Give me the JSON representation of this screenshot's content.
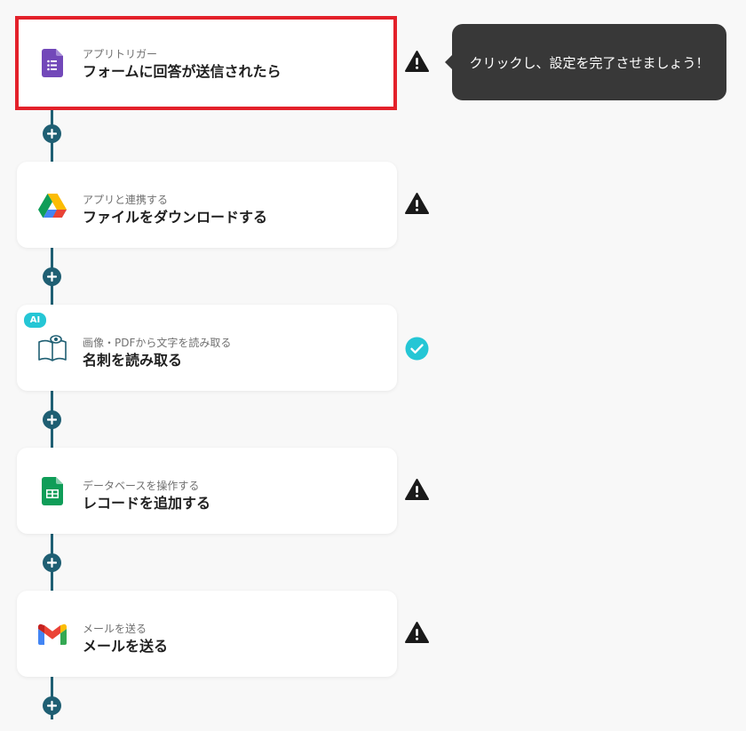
{
  "steps": [
    {
      "subtitle": "アプリトリガー",
      "title": "フォームに回答が送信されたら",
      "icon": "google-forms-icon",
      "status": "warning",
      "selected": true
    },
    {
      "subtitle": "アプリと連携する",
      "title": "ファイルをダウンロードする",
      "icon": "google-drive-icon",
      "status": "warning"
    },
    {
      "subtitle": "画像・PDFから文字を読み取る",
      "title": "名刺を読み取る",
      "icon": "ocr-book-icon",
      "status": "complete",
      "badge": "AI"
    },
    {
      "subtitle": "データベースを操作する",
      "title": "レコードを追加する",
      "icon": "google-sheets-icon",
      "status": "warning"
    },
    {
      "subtitle": "メールを送る",
      "title": "メールを送る",
      "icon": "gmail-icon",
      "status": "warning"
    }
  ],
  "tooltip": {
    "text": "クリックし、設定を完了させましょう！"
  },
  "colors": {
    "connector": "#1f5f73",
    "selected_border": "#e3212a",
    "warning": "#1a1a1a",
    "complete": "#25c6d5",
    "tooltip_bg": "#383838"
  }
}
